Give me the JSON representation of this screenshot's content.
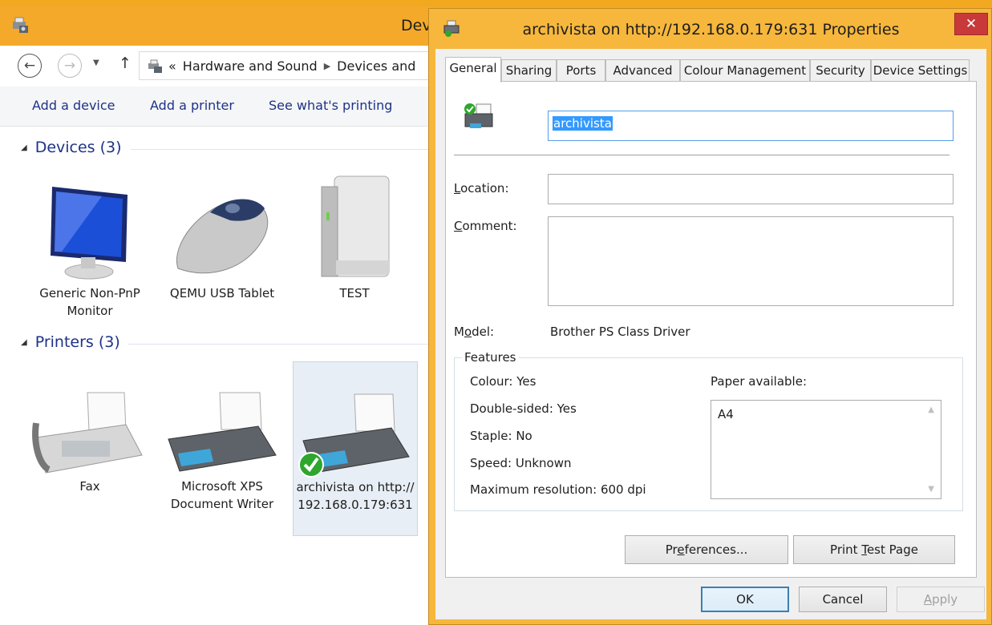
{
  "explorer": {
    "window_title": "Dev",
    "breadcrumb": {
      "overflow": "«",
      "items": [
        "Hardware and Sound",
        "Devices and"
      ]
    },
    "commands": [
      "Add a device",
      "Add a printer",
      "See what's printing"
    ],
    "groups": {
      "devices": {
        "header": "Devices (3)",
        "items": [
          {
            "label": "Generic Non-PnP Monitor",
            "icon": "monitor-icon"
          },
          {
            "label": "QEMU USB Tablet",
            "icon": "mouse-icon"
          },
          {
            "label": "TEST",
            "icon": "drive-icon"
          }
        ]
      },
      "printers": {
        "header": "Printers (3)",
        "items": [
          {
            "label": "Fax",
            "icon": "fax-icon"
          },
          {
            "label": "Microsoft XPS Document Writer",
            "icon": "printer-icon"
          },
          {
            "label": "archivista on http://192.168.0.179:631",
            "icon": "printer-default-icon"
          }
        ]
      }
    }
  },
  "dialog": {
    "title": "archivista on http://192.168.0.179:631 Properties",
    "close_glyph": "✕",
    "tabs": [
      "General",
      "Sharing",
      "Ports",
      "Advanced",
      "Colour Management",
      "Security",
      "Device Settings"
    ],
    "active_tab": "General",
    "printer_name": "archivista",
    "location": {
      "label_pre": "",
      "label_key": "L",
      "label_post": "ocation:",
      "value": ""
    },
    "comment": {
      "label_pre": "",
      "label_key": "C",
      "label_post": "omment:",
      "value": ""
    },
    "model": {
      "label_pre": "M",
      "label_key": "o",
      "label_post": "del:",
      "value": "Brother PS Class Driver"
    },
    "features": {
      "legend": "Features",
      "items": [
        "Colour: Yes",
        "Double-sided: Yes",
        "Staple: No",
        "Speed: Unknown",
        "Maximum resolution: 600 dpi"
      ],
      "paper_label": "Paper available:",
      "paper": [
        "A4"
      ]
    },
    "buttons": {
      "preferences": {
        "pre": "Pr",
        "key": "e",
        "post": "ferences..."
      },
      "print_test": {
        "pre": "Print ",
        "key": "T",
        "post": "est Page"
      },
      "ok": "OK",
      "cancel": "Cancel",
      "apply": {
        "pre": "",
        "key": "A",
        "post": "pply"
      }
    }
  },
  "colors": {
    "titlebar": "#f4a92a",
    "accent_link": "#1e3287",
    "close": "#c8393a",
    "selection": "#3399ff"
  }
}
